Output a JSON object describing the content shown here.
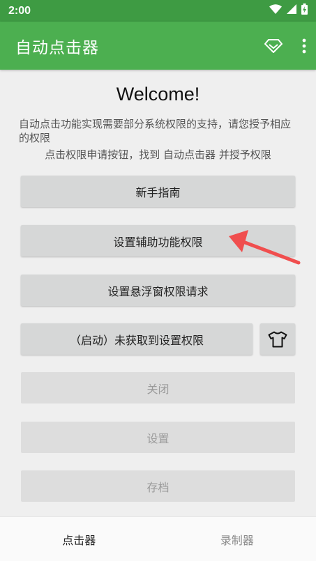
{
  "status_bar": {
    "time": "2:00"
  },
  "app_bar": {
    "title": "自动点击器"
  },
  "content": {
    "welcome": "Welcome!",
    "description": "自动点击功能实现需要部分系统权限的支持，请您授予相应的权限",
    "instruction": "点击权限申请按钮，找到 自动点击器 并授予权限"
  },
  "buttons": {
    "guide": "新手指南",
    "accessibility": "设置辅助功能权限",
    "overlay": "设置悬浮窗权限请求",
    "start": "（启动）未获取到设置权限",
    "close": "关闭",
    "settings": "设置",
    "archive": "存档"
  },
  "bottom_nav": {
    "clicker": "点击器",
    "recorder": "录制器"
  },
  "colors": {
    "primary": "#4caf50",
    "primary_dark": "#3e9b43",
    "button_bg": "#d6d7d7",
    "arrow": "#f04e4e"
  }
}
